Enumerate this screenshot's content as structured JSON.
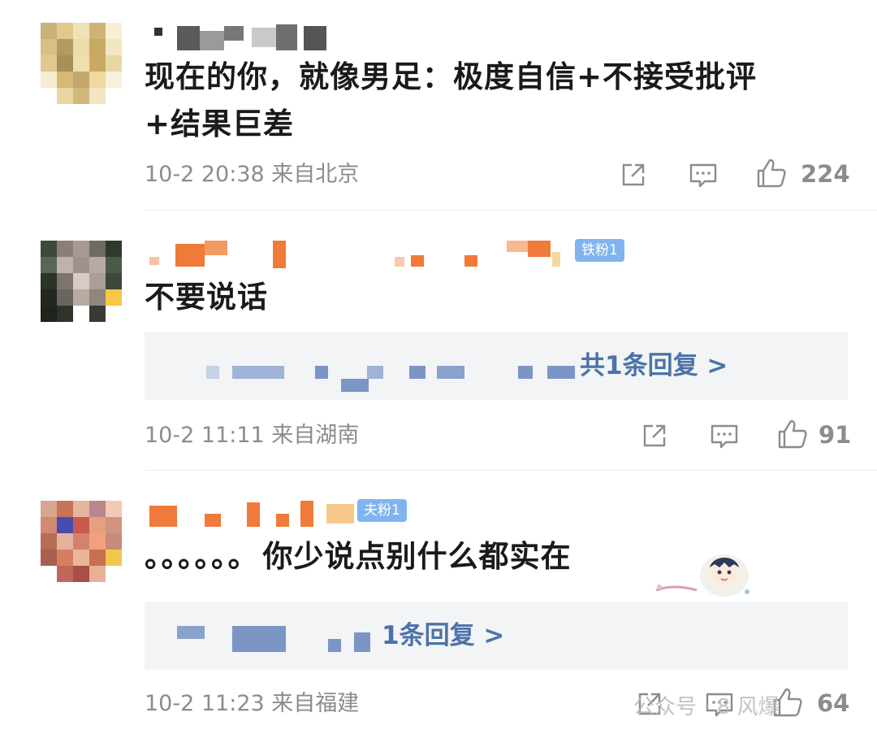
{
  "comments": [
    {
      "text": "现在的你，就像男足：极度自信+不接受批评+结果巨差",
      "text_line1": "现在的你，就像男足：极度自信+不接受批评",
      "text_line2": "+结果巨差",
      "meta": "10-2 20:38 来自北京",
      "likes": "224",
      "avatar_colors": [
        "#c9b27a",
        "#e2c98a",
        "#efe3b6",
        "#cfb277",
        "#f7efd6",
        "#d8bf86",
        "#b39a5e",
        "#eddcaa",
        "#c7a964",
        "#f3e7c2",
        "#e0c98f",
        "#a88f59",
        "#f0dfae",
        "#caa965",
        "#e9d7a3",
        "#f6ecd0",
        "#d4b977",
        "#c1a76d",
        "#efd9a0",
        "#f8f1dc",
        "#ffffff",
        "#e7d5a2",
        "#d3b979",
        "#f2e6c4",
        "#ffffff"
      ]
    },
    {
      "text": "不要说话",
      "badge": "铁粉1",
      "reply_more": "共1条回复 >",
      "meta": "10-2 11:11 来自湖南",
      "likes": "91",
      "avatar_colors": [
        "#3d4a3a",
        "#8a7f78",
        "#a89a92",
        "#6e6a64",
        "#2e3a2c",
        "#586657",
        "#c0b2ab",
        "#9e928c",
        "#b6aaa3",
        "#4b5a48",
        "#2b332a",
        "#7d746f",
        "#d7cbc3",
        "#aa9e98",
        "#3f463c",
        "#22281f",
        "#6a655f",
        "#b7aaa1",
        "#8f867f",
        "#f7c843",
        "#1e231c",
        "#2f342b",
        "#ffffff",
        "#383a33",
        "#ffffff"
      ]
    },
    {
      "text": "。。。。。。你少说点别什么都实在",
      "text_dots": "。。。。。。",
      "text_main": "你少说点别什么都实在",
      "badge": "夫粉1",
      "reply_more": "1条回复 >",
      "meta": "10-2 11:23 来自福建",
      "likes": "64",
      "avatar_colors": [
        "#d9a58c",
        "#c8745a",
        "#e7b49d",
        "#b8868c",
        "#f2c9b5",
        "#cf8a71",
        "#4a4bb0",
        "#c45b4e",
        "#e4a07f",
        "#d1947c",
        "#b76c58",
        "#e2b39c",
        "#d6826a",
        "#f1a27c",
        "#c68b79",
        "#a95f50",
        "#d77d62",
        "#e9b69a",
        "#c6704f",
        "#f3c64a",
        "#ffffff",
        "#c2665b",
        "#a84f46",
        "#e8b197",
        "#ffffff"
      ]
    }
  ],
  "watermark": "公众号 · 8 风爆",
  "colors": {
    "text": "#1a1a1a",
    "meta": "#8c8c8c",
    "link": "#4c73a8",
    "badge": "#7fb4ee",
    "name_orange": "#f07a3a",
    "reply_bg": "#f3f4f6"
  },
  "icons": {
    "share": "share-icon",
    "comment": "comment-icon",
    "like": "thumbs-up-icon"
  }
}
